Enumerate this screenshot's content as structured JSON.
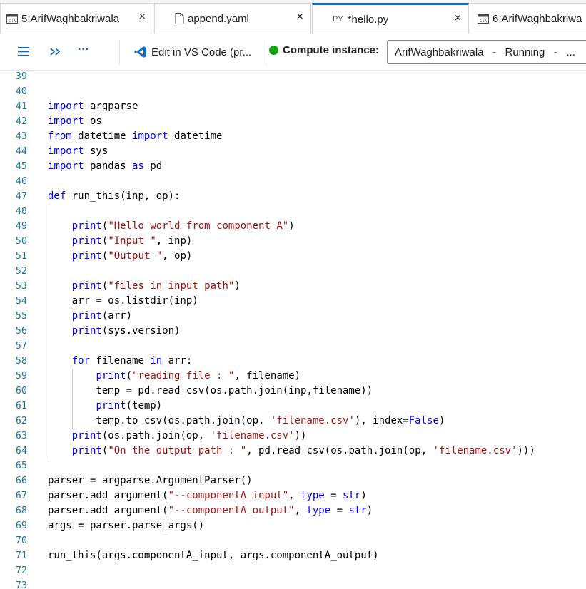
{
  "tabs": [
    {
      "label": "5:ArifWaghbakriwala",
      "icon": "terminal-icon",
      "close": "×"
    },
    {
      "label": "append.yaml",
      "icon": "file-icon",
      "close": "×"
    },
    {
      "label": "*hello.py",
      "icon": "python-icon",
      "prefix": "PY",
      "close": "×",
      "active": true
    },
    {
      "label": "6:ArifWaghbakriwa",
      "icon": "terminal-icon"
    }
  ],
  "toolbar": {
    "menu_icon": "hamburger-icon",
    "run_icon": "run-all-icon",
    "more_icon": "more-icon",
    "more_label": "···",
    "edit_vscode_label": "Edit in VS Code (pr...",
    "compute_label": "Compute instance:",
    "compute_value": "ArifWaghbakriwala   -   Running   -   ..."
  },
  "colors": {
    "accent": "#0f6cbd",
    "status_running": "#13a10e",
    "keyword": "#0000ff",
    "string": "#a31515",
    "function": "#795e26",
    "line_number": "#237893"
  },
  "editor": {
    "lines": [
      {
        "n": "39"
      },
      {
        "n": "40"
      },
      {
        "n": "41",
        "t": [
          {
            "c": "kw",
            "v": "import"
          },
          {
            "v": " argparse"
          }
        ]
      },
      {
        "n": "42",
        "t": [
          {
            "c": "kw",
            "v": "import"
          },
          {
            "v": " os"
          }
        ]
      },
      {
        "n": "43",
        "t": [
          {
            "c": "kw",
            "v": "from"
          },
          {
            "v": " datetime "
          },
          {
            "c": "kw",
            "v": "import"
          },
          {
            "v": " datetime"
          }
        ]
      },
      {
        "n": "44",
        "t": [
          {
            "c": "kw",
            "v": "import"
          },
          {
            "v": " sys"
          }
        ]
      },
      {
        "n": "45",
        "t": [
          {
            "c": "kw",
            "v": "import"
          },
          {
            "v": " pandas "
          },
          {
            "c": "kw",
            "v": "as"
          },
          {
            "v": " pd"
          }
        ]
      },
      {
        "n": "46"
      },
      {
        "n": "47",
        "t": [
          {
            "c": "kw",
            "v": "def"
          },
          {
            "v": " run_this(inp, op):"
          }
        ]
      },
      {
        "n": "48"
      },
      {
        "n": "49",
        "t": [
          {
            "v": "    "
          },
          {
            "c": "kw",
            "v": "print"
          },
          {
            "v": "("
          },
          {
            "c": "str",
            "v": "\"Hello world from component A\""
          },
          {
            "v": ")"
          }
        ]
      },
      {
        "n": "50",
        "t": [
          {
            "v": "    "
          },
          {
            "c": "kw",
            "v": "print"
          },
          {
            "v": "("
          },
          {
            "c": "str",
            "v": "\"Input \""
          },
          {
            "v": ", inp)"
          }
        ]
      },
      {
        "n": "51",
        "t": [
          {
            "v": "    "
          },
          {
            "c": "kw",
            "v": "print"
          },
          {
            "v": "("
          },
          {
            "c": "str",
            "v": "\"Output \""
          },
          {
            "v": ", op)"
          }
        ]
      },
      {
        "n": "52"
      },
      {
        "n": "53",
        "t": [
          {
            "v": "    "
          },
          {
            "c": "kw",
            "v": "print"
          },
          {
            "v": "("
          },
          {
            "c": "str",
            "v": "\"files in input path\""
          },
          {
            "v": ")"
          }
        ]
      },
      {
        "n": "54",
        "t": [
          {
            "v": "    arr = os.listdir(inp)"
          }
        ]
      },
      {
        "n": "55",
        "t": [
          {
            "v": "    "
          },
          {
            "c": "kw",
            "v": "print"
          },
          {
            "v": "(arr)"
          }
        ]
      },
      {
        "n": "56",
        "t": [
          {
            "v": "    "
          },
          {
            "c": "kw",
            "v": "print"
          },
          {
            "v": "(sys.version)"
          }
        ]
      },
      {
        "n": "57"
      },
      {
        "n": "58",
        "t": [
          {
            "v": "    "
          },
          {
            "c": "kw",
            "v": "for"
          },
          {
            "v": " filename "
          },
          {
            "c": "kw",
            "v": "in"
          },
          {
            "v": " arr:"
          }
        ]
      },
      {
        "n": "59",
        "t": [
          {
            "v": "        "
          },
          {
            "c": "kw",
            "v": "print"
          },
          {
            "v": "("
          },
          {
            "c": "str",
            "v": "\"reading file : \""
          },
          {
            "v": ", filename)"
          }
        ]
      },
      {
        "n": "60",
        "t": [
          {
            "v": "        temp = pd.read_csv(os.path.join(inp,filename))"
          }
        ]
      },
      {
        "n": "61",
        "t": [
          {
            "v": "        "
          },
          {
            "c": "kw",
            "v": "print"
          },
          {
            "v": "(temp)"
          }
        ]
      },
      {
        "n": "62",
        "t": [
          {
            "v": "        temp.to_csv(os.path.join(op, "
          },
          {
            "c": "str",
            "v": "'filename.csv'"
          },
          {
            "v": "), index="
          },
          {
            "c": "kw",
            "v": "False"
          },
          {
            "v": ")"
          }
        ]
      },
      {
        "n": "63",
        "t": [
          {
            "v": "    "
          },
          {
            "c": "kw",
            "v": "print"
          },
          {
            "v": "(os.path.join(op, "
          },
          {
            "c": "str",
            "v": "'filename.csv'"
          },
          {
            "v": "))"
          }
        ]
      },
      {
        "n": "64",
        "t": [
          {
            "v": "    "
          },
          {
            "c": "kw",
            "v": "print"
          },
          {
            "v": "("
          },
          {
            "c": "str",
            "v": "\"On the output path : \""
          },
          {
            "v": ", pd.read_csv(os.path.join(op, "
          },
          {
            "c": "str",
            "v": "'filename.csv'"
          },
          {
            "v": ")))"
          }
        ]
      },
      {
        "n": "65"
      },
      {
        "n": "66",
        "t": [
          {
            "v": "parser = argparse.ArgumentParser()"
          }
        ]
      },
      {
        "n": "67",
        "t": [
          {
            "v": "parser.add_argument("
          },
          {
            "c": "str",
            "v": "\"--componentA_input\""
          },
          {
            "v": ", "
          },
          {
            "c": "kw",
            "v": "type"
          },
          {
            "v": " = "
          },
          {
            "c": "kw",
            "v": "str"
          },
          {
            "v": ")"
          }
        ]
      },
      {
        "n": "68",
        "t": [
          {
            "v": "parser.add_argument("
          },
          {
            "c": "str",
            "v": "\"--componentA_output\""
          },
          {
            "v": ", "
          },
          {
            "c": "kw",
            "v": "type"
          },
          {
            "v": " = "
          },
          {
            "c": "kw",
            "v": "str"
          },
          {
            "v": ")"
          }
        ]
      },
      {
        "n": "69",
        "t": [
          {
            "v": "args = parser.parse_args()"
          }
        ]
      },
      {
        "n": "70"
      },
      {
        "n": "71",
        "t": [
          {
            "v": "run_this(args.componentA_input, args.componentA_output)"
          }
        ]
      },
      {
        "n": "72"
      },
      {
        "n": "73"
      }
    ]
  }
}
